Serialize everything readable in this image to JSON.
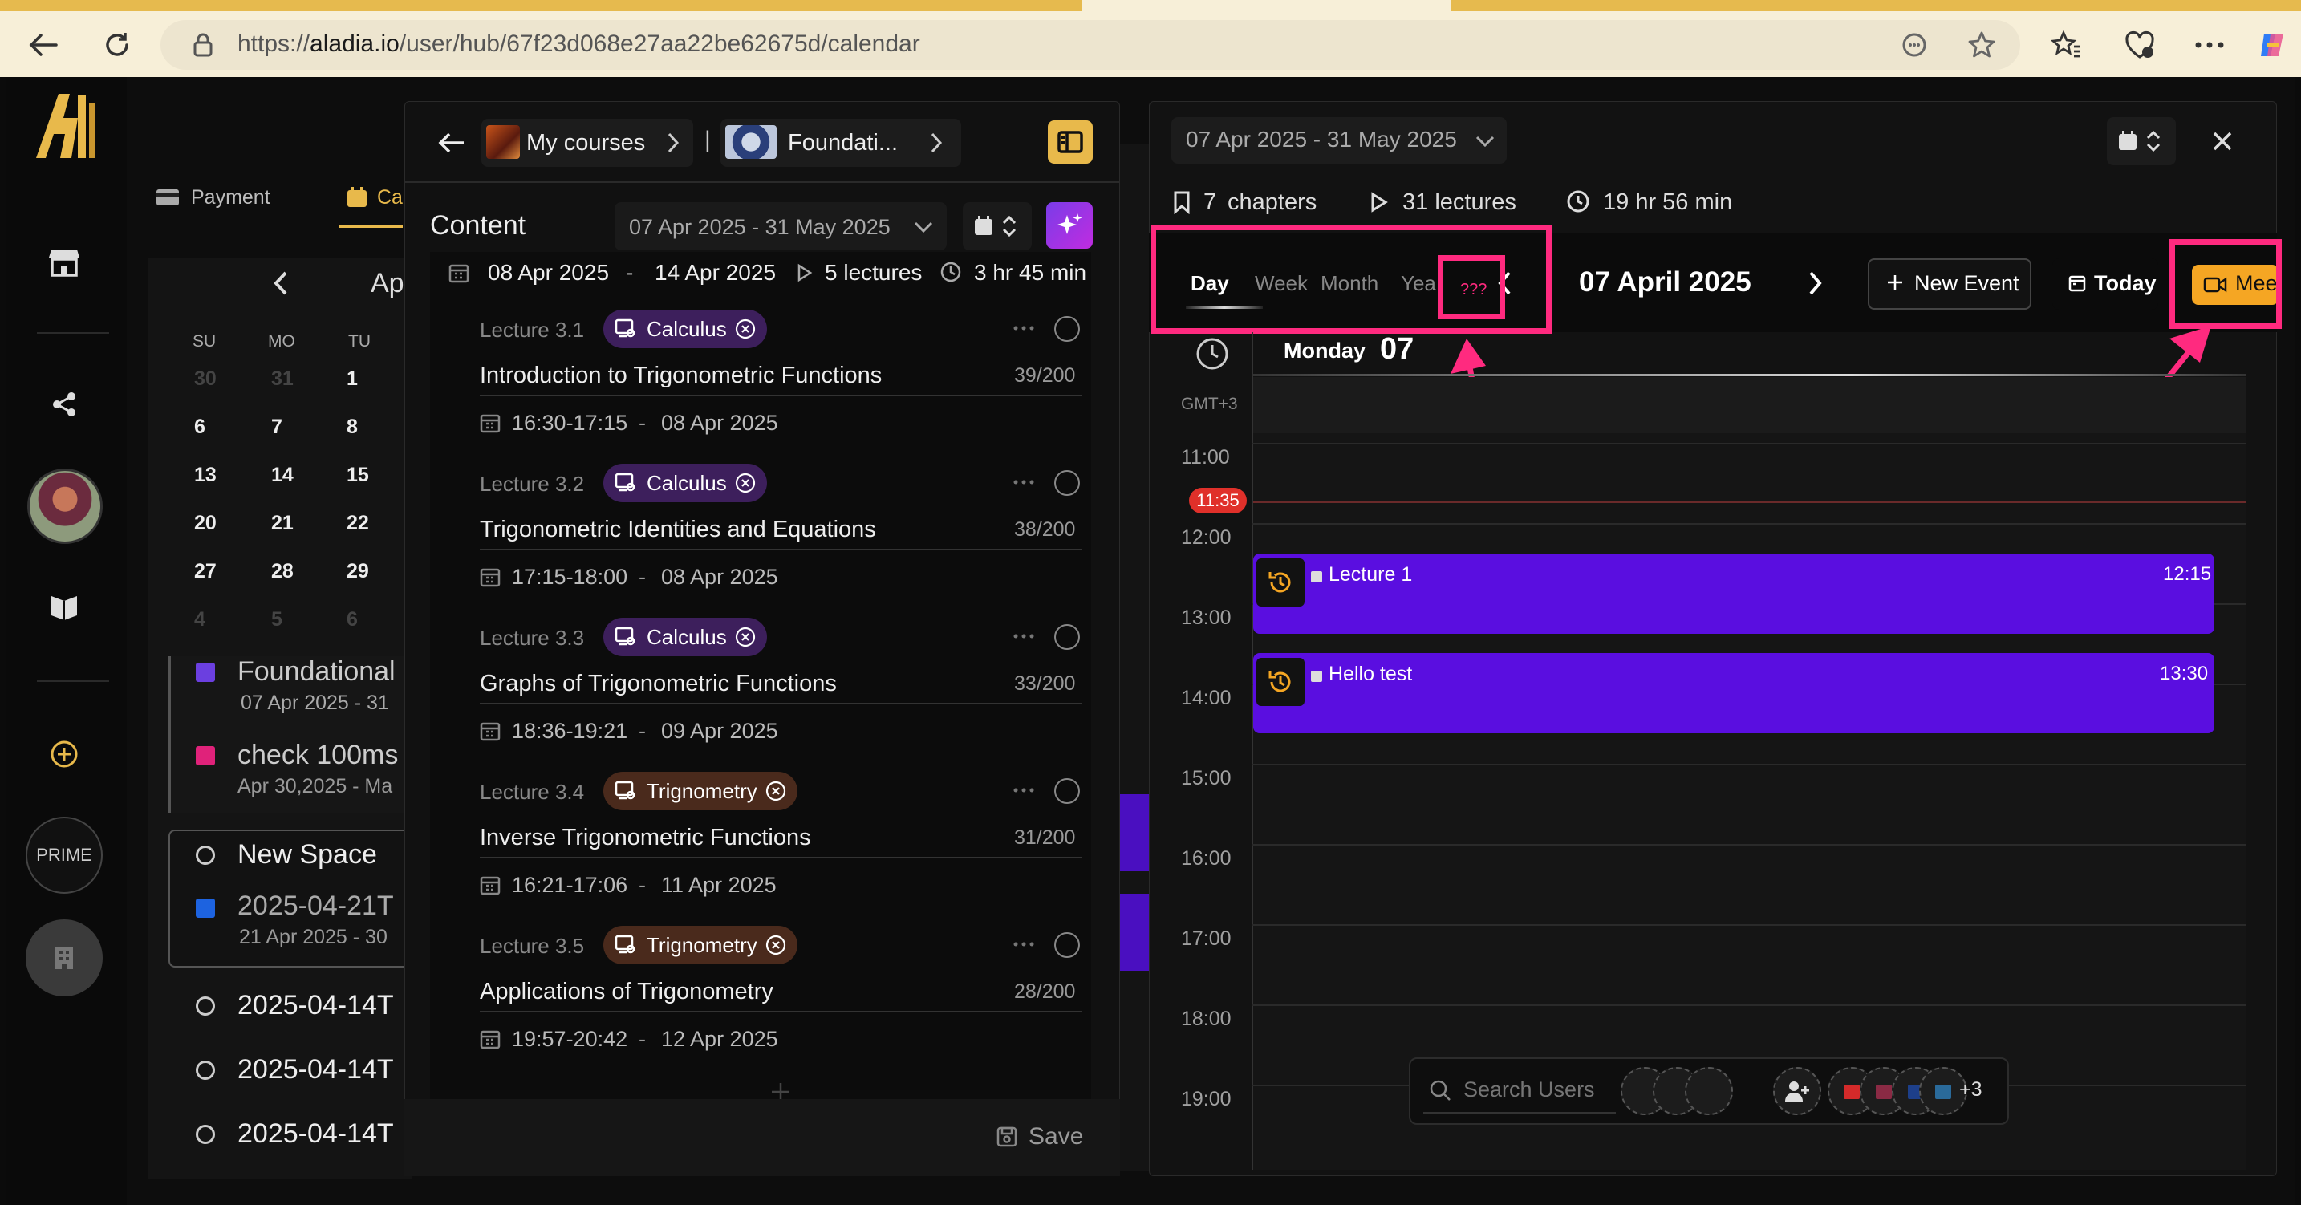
{
  "browser": {
    "url_prefix": "https://",
    "url_domain": "aladia.io",
    "url_path": "/user/hub/67f23d068e27aa22be62675d/calendar"
  },
  "sidebar": {
    "logo": "logo-icon",
    "items": [
      "store-icon",
      "share-icon",
      "avatar",
      "book-icon",
      "add-circle-icon",
      "prime-badge",
      "building-icon"
    ],
    "prime_label": "PRIME"
  },
  "back_panel": {
    "tabs": [
      {
        "label": "Payment",
        "icon": "card-icon"
      },
      {
        "label": "Ca",
        "icon": "calendar-icon"
      }
    ],
    "month_label": "Ap",
    "weekdays": [
      "SU",
      "MO",
      "TU"
    ],
    "weeks": [
      [
        "30",
        "31",
        "1"
      ],
      [
        "6",
        "7",
        "8"
      ],
      [
        "13",
        "14",
        "15"
      ],
      [
        "20",
        "21",
        "22"
      ],
      [
        "27",
        "28",
        "29"
      ],
      [
        "4",
        "5",
        "6"
      ]
    ],
    "spaces": [
      {
        "title": "Foundational",
        "sub": "07 Apr 2025 - 31",
        "color": "#6b3fe0"
      },
      {
        "title": "check 100ms",
        "sub": "Apr 30,2025 - Ma",
        "color": "#e0227a"
      }
    ],
    "new_space": {
      "title": "New Space",
      "item_title": "2025-04-21T",
      "item_sub": "21 Apr 2025 - 30"
    },
    "rows": [
      "2025-04-14T",
      "2025-04-14T",
      "2025-04-14T"
    ]
  },
  "course_panel": {
    "crumb1": "My courses",
    "crumb_sep": "|",
    "crumb2": "Foundati...",
    "content_label": "Content",
    "date_range": "07 Apr 2025 - 31 May 2025",
    "week": {
      "start": "08 Apr 2025",
      "dash": "-",
      "end": "14 Apr 2025",
      "lectures": "5 lectures",
      "duration": "3 hr 45 min"
    },
    "lectures": [
      {
        "num": "Lecture 3.1",
        "tag": "Calculus",
        "title": "Introduction to Trigonometric Functions",
        "count": "39/200",
        "time": "16:30-17:15",
        "date": "08 Apr 2025",
        "tag_color": "#3d1f5c"
      },
      {
        "num": "Lecture 3.2",
        "tag": "Calculus",
        "title": "Trigonometric Identities and Equations",
        "count": "38/200",
        "time": "17:15-18:00",
        "date": "08 Apr 2025",
        "tag_color": "#3d1f5c"
      },
      {
        "num": "Lecture 3.3",
        "tag": "Calculus",
        "title": "Graphs of Trigonometric Functions",
        "count": "33/200",
        "time": "18:36-19:21",
        "date": "09 Apr 2025",
        "tag_color": "#3d1f5c"
      },
      {
        "num": "Lecture 3.4",
        "tag": "Trignometry",
        "title": "Inverse Trigonometric Functions",
        "count": "31/200",
        "time": "16:21-17:06",
        "date": "11 Apr 2025",
        "tag_color": "#4a2a1c"
      },
      {
        "num": "Lecture 3.5",
        "tag": "Trignometry",
        "title": "Applications of Trigonometry",
        "count": "28/200",
        "time": "19:57-20:42",
        "date": "12 Apr 2025",
        "tag_color": "#4a2a1c"
      }
    ],
    "dash": "-",
    "save_label": "Save"
  },
  "calendar_panel": {
    "date_range": "07 Apr 2025 - 31 May 2025",
    "stats": {
      "chapters_num": "7",
      "chapters_label": "chapters",
      "lectures": "31 lectures",
      "duration": "19 hr 56 min"
    },
    "views": [
      "Day",
      "Week",
      "Month",
      "Yea"
    ],
    "active_view": "Day",
    "annotation": "???",
    "current_date": "07 April 2025",
    "new_event_label": "New Event",
    "today_label": "Today",
    "meet_label": "Mee",
    "day_name": "Monday",
    "day_num": "07",
    "timezone": "GMT+3",
    "hours": [
      "11:00",
      "12:00",
      "13:00",
      "14:00",
      "15:00",
      "16:00",
      "17:00",
      "18:00",
      "19:00"
    ],
    "now_label": "11:35",
    "events": [
      {
        "title": "Lecture 1",
        "time": "12:15"
      },
      {
        "title": "Hello test",
        "time": "13:30"
      }
    ],
    "search_placeholder": "Search Users",
    "extra_count": "+3",
    "accent": "#f5a623",
    "event_color": "#5a0ee0",
    "highlight_color": "#ff2a7f"
  }
}
